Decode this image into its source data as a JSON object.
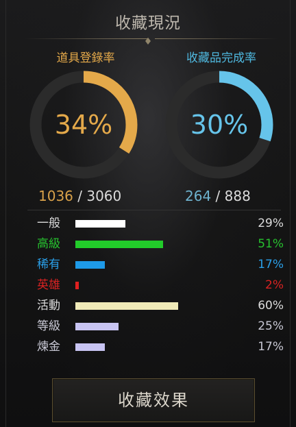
{
  "panel": {
    "title": "收藏現況"
  },
  "item_registration": {
    "label": "道具登錄率",
    "percent": 34,
    "percent_text": "34%",
    "current": "1036",
    "separator": " / ",
    "total": "3060",
    "color": "#e4a94a"
  },
  "collection_completion": {
    "label": "收藏品完成率",
    "percent": 30,
    "percent_text": "30%",
    "current": "264",
    "separator": " / ",
    "total": "888",
    "color": "#66c4ea"
  },
  "grades": [
    {
      "name": "一般",
      "percent": 29,
      "percent_text": "29%",
      "bar_color": "#ffffff",
      "name_color": "#dcdcdc",
      "pct_color": "#dcdcdc"
    },
    {
      "name": "高級",
      "percent": 51,
      "percent_text": "51%",
      "bar_color": "#22cc2a",
      "name_color": "#27c22f",
      "pct_color": "#27c22f"
    },
    {
      "name": "稀有",
      "percent": 17,
      "percent_text": "17%",
      "bar_color": "#1e9ae8",
      "name_color": "#2a9fe8",
      "pct_color": "#2a9fe8"
    },
    {
      "name": "英雄",
      "percent": 2,
      "percent_text": "2%",
      "bar_color": "#e02020",
      "name_color": "#d82222",
      "pct_color": "#d82222"
    },
    {
      "name": "活動",
      "percent": 60,
      "percent_text": "60%",
      "bar_color": "#f0eab8",
      "name_color": "#dcdcdc",
      "pct_color": "#dcdcdc"
    },
    {
      "name": "等級",
      "percent": 25,
      "percent_text": "25%",
      "bar_color": "#c8c4f2",
      "name_color": "#c8c8d4",
      "pct_color": "#c8c8d4"
    },
    {
      "name": "煉金",
      "percent": 17,
      "percent_text": "17%",
      "bar_color": "#c8c4f2",
      "name_color": "#c8c8d4",
      "pct_color": "#c8c8d4"
    }
  ],
  "effect_button": {
    "label": "收藏效果"
  }
}
